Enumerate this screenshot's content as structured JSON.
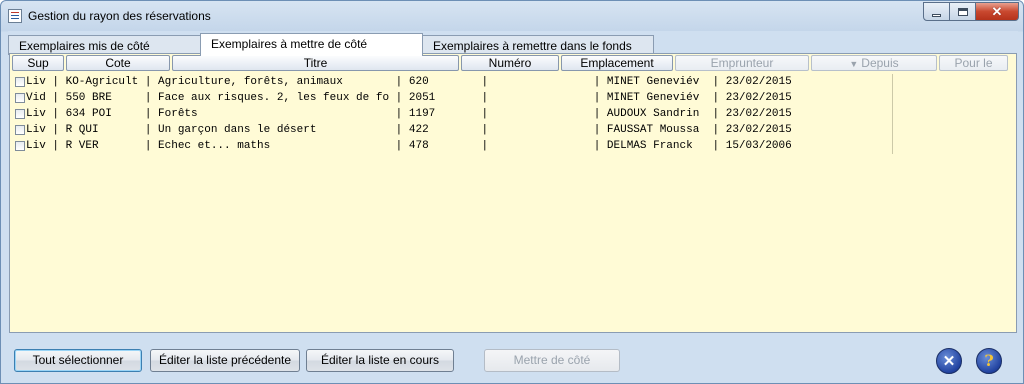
{
  "window": {
    "title": "Gestion du rayon des réservations"
  },
  "tabs": [
    {
      "label": "Exemplaires mis de côté",
      "active": false
    },
    {
      "label": "Exemplaires à mettre de côté",
      "active": true
    },
    {
      "label": "Exemplaires à remettre dans le fonds",
      "active": false
    }
  ],
  "columns": [
    {
      "label": "Sup",
      "enabled": true
    },
    {
      "label": "Cote",
      "enabled": true
    },
    {
      "label": "Titre",
      "enabled": true
    },
    {
      "label": "Numéro",
      "enabled": true
    },
    {
      "label": "Emplacement",
      "enabled": true
    },
    {
      "label": "Emprunteur",
      "enabled": false
    },
    {
      "label": "Depuis",
      "enabled": false,
      "sort_icon": "down-arrow-icon"
    },
    {
      "label": "Pour le",
      "enabled": false
    }
  ],
  "rows": [
    {
      "text": "Liv | KO-Agricult | Agriculture, forêts, animaux        | 620        |                | MINET Geneviév  | 23/02/2015"
    },
    {
      "text": "Vid | 550 BRE     | Face aux risques. 2, les feux de fo | 2051       |                | MINET Geneviév  | 23/02/2015"
    },
    {
      "text": "Liv | 634 POI     | Forêts                              | 1197       |                | AUDOUX Sandrin  | 23/02/2015"
    },
    {
      "text": "Liv | R QUI       | Un garçon dans le désert            | 422        |                | FAUSSAT Moussa  | 23/02/2015"
    },
    {
      "text": "Liv | R VER       | Echec et... maths                   | 478        |                | DELMAS Franck   | 15/03/2006"
    }
  ],
  "buttons": {
    "select_all": "Tout sélectionner",
    "edit_previous": "Éditer la liste précédente",
    "edit_current": "Éditer la liste en cours",
    "set_aside": "Mettre de côté"
  },
  "icons": {
    "quit": "close-circle-icon",
    "help": "help-circle-icon"
  },
  "colors": {
    "panel_bg": "#fffbd6",
    "window_bg": "#cfdff0"
  }
}
